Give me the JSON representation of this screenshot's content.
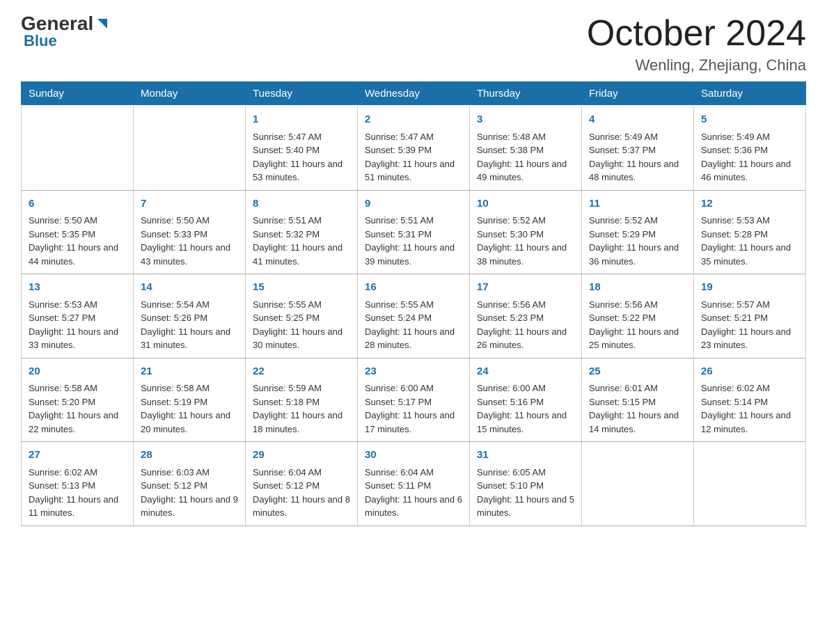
{
  "logo": {
    "general": "General",
    "blue": "Blue"
  },
  "title": "October 2024",
  "location": "Wenling, Zhejiang, China",
  "days_of_week": [
    "Sunday",
    "Monday",
    "Tuesday",
    "Wednesday",
    "Thursday",
    "Friday",
    "Saturday"
  ],
  "weeks": [
    [
      {
        "day": "",
        "sunrise": "",
        "sunset": "",
        "daylight": ""
      },
      {
        "day": "",
        "sunrise": "",
        "sunset": "",
        "daylight": ""
      },
      {
        "day": "1",
        "sunrise": "Sunrise: 5:47 AM",
        "sunset": "Sunset: 5:40 PM",
        "daylight": "Daylight: 11 hours and 53 minutes."
      },
      {
        "day": "2",
        "sunrise": "Sunrise: 5:47 AM",
        "sunset": "Sunset: 5:39 PM",
        "daylight": "Daylight: 11 hours and 51 minutes."
      },
      {
        "day": "3",
        "sunrise": "Sunrise: 5:48 AM",
        "sunset": "Sunset: 5:38 PM",
        "daylight": "Daylight: 11 hours and 49 minutes."
      },
      {
        "day": "4",
        "sunrise": "Sunrise: 5:49 AM",
        "sunset": "Sunset: 5:37 PM",
        "daylight": "Daylight: 11 hours and 48 minutes."
      },
      {
        "day": "5",
        "sunrise": "Sunrise: 5:49 AM",
        "sunset": "Sunset: 5:36 PM",
        "daylight": "Daylight: 11 hours and 46 minutes."
      }
    ],
    [
      {
        "day": "6",
        "sunrise": "Sunrise: 5:50 AM",
        "sunset": "Sunset: 5:35 PM",
        "daylight": "Daylight: 11 hours and 44 minutes."
      },
      {
        "day": "7",
        "sunrise": "Sunrise: 5:50 AM",
        "sunset": "Sunset: 5:33 PM",
        "daylight": "Daylight: 11 hours and 43 minutes."
      },
      {
        "day": "8",
        "sunrise": "Sunrise: 5:51 AM",
        "sunset": "Sunset: 5:32 PM",
        "daylight": "Daylight: 11 hours and 41 minutes."
      },
      {
        "day": "9",
        "sunrise": "Sunrise: 5:51 AM",
        "sunset": "Sunset: 5:31 PM",
        "daylight": "Daylight: 11 hours and 39 minutes."
      },
      {
        "day": "10",
        "sunrise": "Sunrise: 5:52 AM",
        "sunset": "Sunset: 5:30 PM",
        "daylight": "Daylight: 11 hours and 38 minutes."
      },
      {
        "day": "11",
        "sunrise": "Sunrise: 5:52 AM",
        "sunset": "Sunset: 5:29 PM",
        "daylight": "Daylight: 11 hours and 36 minutes."
      },
      {
        "day": "12",
        "sunrise": "Sunrise: 5:53 AM",
        "sunset": "Sunset: 5:28 PM",
        "daylight": "Daylight: 11 hours and 35 minutes."
      }
    ],
    [
      {
        "day": "13",
        "sunrise": "Sunrise: 5:53 AM",
        "sunset": "Sunset: 5:27 PM",
        "daylight": "Daylight: 11 hours and 33 minutes."
      },
      {
        "day": "14",
        "sunrise": "Sunrise: 5:54 AM",
        "sunset": "Sunset: 5:26 PM",
        "daylight": "Daylight: 11 hours and 31 minutes."
      },
      {
        "day": "15",
        "sunrise": "Sunrise: 5:55 AM",
        "sunset": "Sunset: 5:25 PM",
        "daylight": "Daylight: 11 hours and 30 minutes."
      },
      {
        "day": "16",
        "sunrise": "Sunrise: 5:55 AM",
        "sunset": "Sunset: 5:24 PM",
        "daylight": "Daylight: 11 hours and 28 minutes."
      },
      {
        "day": "17",
        "sunrise": "Sunrise: 5:56 AM",
        "sunset": "Sunset: 5:23 PM",
        "daylight": "Daylight: 11 hours and 26 minutes."
      },
      {
        "day": "18",
        "sunrise": "Sunrise: 5:56 AM",
        "sunset": "Sunset: 5:22 PM",
        "daylight": "Daylight: 11 hours and 25 minutes."
      },
      {
        "day": "19",
        "sunrise": "Sunrise: 5:57 AM",
        "sunset": "Sunset: 5:21 PM",
        "daylight": "Daylight: 11 hours and 23 minutes."
      }
    ],
    [
      {
        "day": "20",
        "sunrise": "Sunrise: 5:58 AM",
        "sunset": "Sunset: 5:20 PM",
        "daylight": "Daylight: 11 hours and 22 minutes."
      },
      {
        "day": "21",
        "sunrise": "Sunrise: 5:58 AM",
        "sunset": "Sunset: 5:19 PM",
        "daylight": "Daylight: 11 hours and 20 minutes."
      },
      {
        "day": "22",
        "sunrise": "Sunrise: 5:59 AM",
        "sunset": "Sunset: 5:18 PM",
        "daylight": "Daylight: 11 hours and 18 minutes."
      },
      {
        "day": "23",
        "sunrise": "Sunrise: 6:00 AM",
        "sunset": "Sunset: 5:17 PM",
        "daylight": "Daylight: 11 hours and 17 minutes."
      },
      {
        "day": "24",
        "sunrise": "Sunrise: 6:00 AM",
        "sunset": "Sunset: 5:16 PM",
        "daylight": "Daylight: 11 hours and 15 minutes."
      },
      {
        "day": "25",
        "sunrise": "Sunrise: 6:01 AM",
        "sunset": "Sunset: 5:15 PM",
        "daylight": "Daylight: 11 hours and 14 minutes."
      },
      {
        "day": "26",
        "sunrise": "Sunrise: 6:02 AM",
        "sunset": "Sunset: 5:14 PM",
        "daylight": "Daylight: 11 hours and 12 minutes."
      }
    ],
    [
      {
        "day": "27",
        "sunrise": "Sunrise: 6:02 AM",
        "sunset": "Sunset: 5:13 PM",
        "daylight": "Daylight: 11 hours and 11 minutes."
      },
      {
        "day": "28",
        "sunrise": "Sunrise: 6:03 AM",
        "sunset": "Sunset: 5:12 PM",
        "daylight": "Daylight: 11 hours and 9 minutes."
      },
      {
        "day": "29",
        "sunrise": "Sunrise: 6:04 AM",
        "sunset": "Sunset: 5:12 PM",
        "daylight": "Daylight: 11 hours and 8 minutes."
      },
      {
        "day": "30",
        "sunrise": "Sunrise: 6:04 AM",
        "sunset": "Sunset: 5:11 PM",
        "daylight": "Daylight: 11 hours and 6 minutes."
      },
      {
        "day": "31",
        "sunrise": "Sunrise: 6:05 AM",
        "sunset": "Sunset: 5:10 PM",
        "daylight": "Daylight: 11 hours and 5 minutes."
      },
      {
        "day": "",
        "sunrise": "",
        "sunset": "",
        "daylight": ""
      },
      {
        "day": "",
        "sunrise": "",
        "sunset": "",
        "daylight": ""
      }
    ]
  ]
}
